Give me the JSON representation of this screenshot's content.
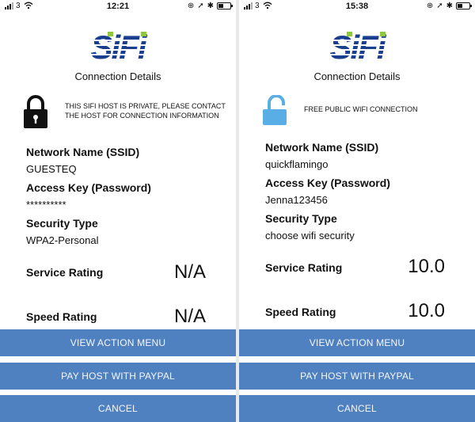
{
  "screens": [
    {
      "status": {
        "carrier": "3",
        "time": "12:21"
      },
      "subtitle": "Connection Details",
      "notice": "THIS SIFI HOST IS PRIVATE, PLEASE CONTACT THE HOST FOR CONNECTION INFORMATION",
      "lock_state": "locked",
      "lock_color": "#111111",
      "fields": [
        {
          "label": "Network Name (SSID)",
          "value": "GUESTEQ"
        },
        {
          "label": "Access Key (Password)",
          "value": "**********"
        },
        {
          "label": "Security Type",
          "value": "WPA2-Personal"
        }
      ],
      "ratings": [
        {
          "label": "Service Rating",
          "value": "N/A"
        },
        {
          "label": "Speed Rating",
          "value": "N/A"
        }
      ],
      "buttons": [
        "VIEW ACTION MENU",
        "PAY HOST WITH PAYPAL",
        "CANCEL"
      ]
    },
    {
      "status": {
        "carrier": "3",
        "time": "15:38"
      },
      "subtitle": "Connection Details",
      "notice": "FREE PUBLIC WIFI CONNECTION",
      "lock_state": "unlocked",
      "lock_color": "#5aaee6",
      "fields": [
        {
          "label": "Network Name (SSID)",
          "value": "quickflamingo"
        },
        {
          "label": "Access Key (Password)",
          "value": "Jenna123456"
        },
        {
          "label": "Security Type",
          "value": "choose wifi security"
        }
      ],
      "ratings": [
        {
          "label": "Service Rating",
          "value": "10.0"
        },
        {
          "label": "Speed Rating",
          "value": "10.0"
        }
      ],
      "buttons": [
        "VIEW ACTION MENU",
        "PAY HOST WITH PAYPAL",
        "CANCEL"
      ]
    }
  ],
  "brand": {
    "primary": "#1a3f8f",
    "accent": "#8fc742",
    "button": "#4f80c0"
  }
}
